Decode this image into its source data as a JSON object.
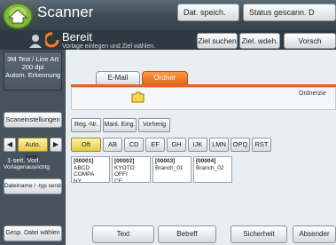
{
  "titlebar": {
    "title": "Scanner",
    "btn_save_file": "Dat. speich.",
    "btn_status": "Status gescann. D"
  },
  "status": {
    "state": "Bereit",
    "hint": "Vorlage einlegen und Ziel wählen.",
    "btn_search_dest": "Ziel suchen",
    "btn_dest_history": "Ziel. wdeh.",
    "btn_preview": "Vorsch"
  },
  "left_panel": {
    "resolution": [
      "3M Text / Line Art",
      "200 dpi",
      "Autom. Erkennung"
    ],
    "btn_scan_settings": "Scaneinstellungen",
    "density_label": "Auto. Helli.",
    "scan_type_line1": "1-seit. Vorl.",
    "scan_type_line2": "Vorlagenausrichtg",
    "btn_file_type": "Dateiname / -typ senden",
    "btn_send_stored": "Gesp. Datei wählen"
  },
  "tabs": {
    "email": "E-Mail",
    "folder": "Ordner"
  },
  "folder_area": {
    "label": "Ordnerzie"
  },
  "action_buttons": [
    "Reg.-Nr.",
    "Manl. Eing.",
    "Vorherig"
  ],
  "index_keys": [
    "Oft",
    "AB",
    "CD",
    "EF",
    "GH",
    "IJK",
    "LMN",
    "OPQ",
    "RST"
  ],
  "active_index": "Oft",
  "destinations": [
    {
      "code": "[00001]",
      "line1": "ABCD COMPA",
      "line2": "NY"
    },
    {
      "code": "[00002]",
      "line1": "KYOTO OFFI",
      "line2": "CE"
    },
    {
      "code": "[00003]",
      "line1": "Branch_01",
      "line2": ""
    },
    {
      "code": "[00004]",
      "line1": "Branch_02",
      "line2": ""
    }
  ],
  "bottom_buttons": {
    "text": "Text",
    "subject": "Betreff",
    "security": "Sicherheit",
    "sender": "Absender"
  }
}
